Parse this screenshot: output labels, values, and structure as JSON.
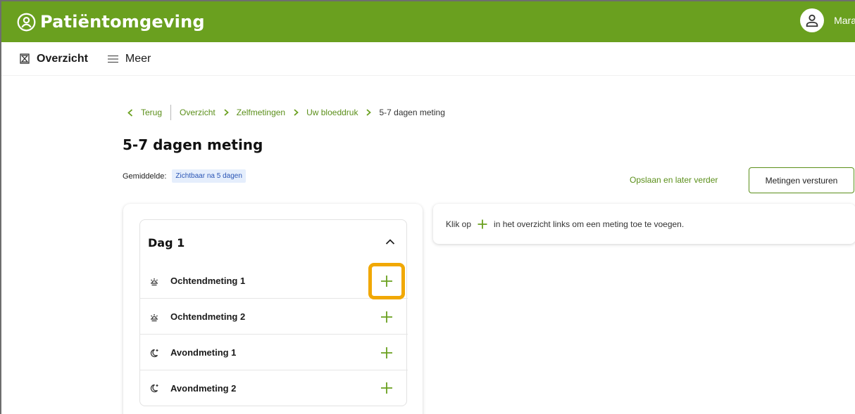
{
  "header": {
    "title": "Patiëntomgeving",
    "user_name": "Mara"
  },
  "nav": {
    "overzicht": "Overzicht",
    "meer": "Meer"
  },
  "breadcrumb": {
    "back": "Terug",
    "items": [
      "Overzicht",
      "Zelfmetingen",
      "Uw bloeddruk"
    ],
    "current": "5-7 dagen meting"
  },
  "page": {
    "title": "5-7 dagen meting",
    "average_label": "Gemiddelde:",
    "average_badge": "Zichtbaar na 5 dagen"
  },
  "actions": {
    "save_later": "Opslaan en later verder",
    "send": "Metingen versturen"
  },
  "day": {
    "title": "Dag 1",
    "measurements": [
      {
        "label": "Ochtendmeting 1",
        "icon": "sunrise-icon"
      },
      {
        "label": "Ochtendmeting 2",
        "icon": "sunrise-icon"
      },
      {
        "label": "Avondmeting 1",
        "icon": "moon-icon"
      },
      {
        "label": "Avondmeting 2",
        "icon": "moon-icon"
      }
    ]
  },
  "hint": {
    "before": "Klik op",
    "after": "in het overzicht links om een meting toe te voegen."
  },
  "colors": {
    "brand": "#6aa01f",
    "link": "#5b8f1a",
    "highlight": "#f1a804",
    "badge_bg": "#e5eefc"
  }
}
